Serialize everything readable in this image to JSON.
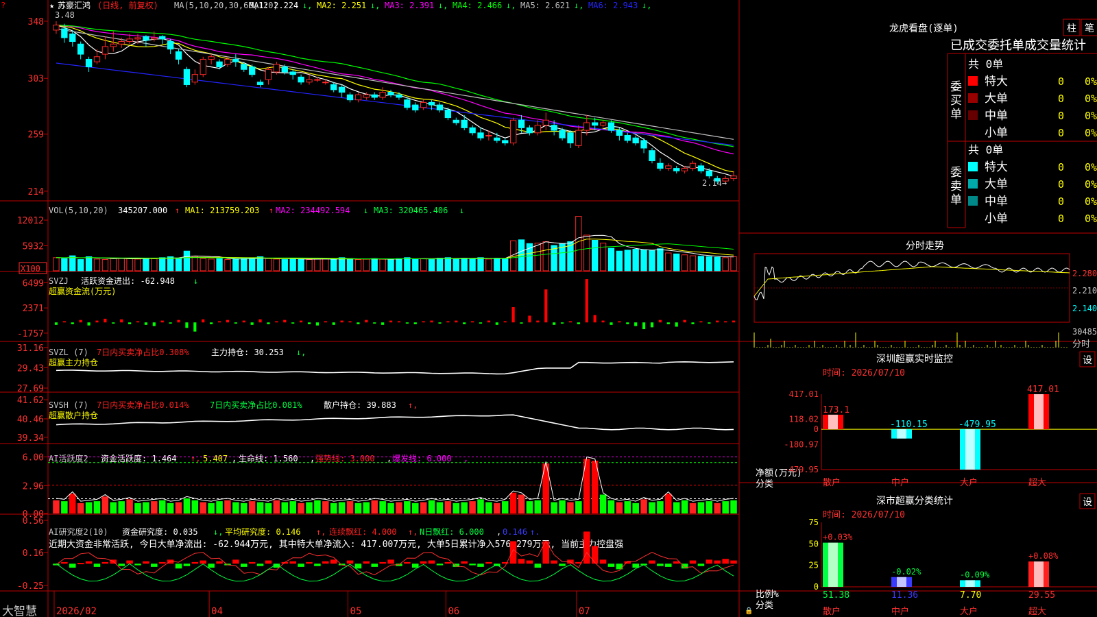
{
  "colors": {
    "up": "#ff2a2a",
    "down": "#00ffff",
    "ma1": "#ffffff",
    "ma2": "#ffff00",
    "ma3": "#ff00ff",
    "ma4": "#00ff00",
    "ma5": "#c0c0c0",
    "ma6": "#2424ff",
    "frame": "#c00000",
    "axisText": "#ff3030",
    "green": "#00ff40",
    "white": "#ffffff",
    "yellow": "#ffff00"
  },
  "kline": {
    "stock_name": "苏豪汇鸿",
    "period": "(日线, 前复权)",
    "ma_params": "MA(5,10,20,30,60,120)",
    "ma_values": [
      {
        "label": "MA1:",
        "value": "2.224",
        "arrow": "↓"
      },
      {
        "label": "MA2:",
        "value": "2.251",
        "arrow": "↓"
      },
      {
        "label": "MA3:",
        "value": "2.391",
        "arrow": "↓"
      },
      {
        "label": "MA4:",
        "value": "2.466",
        "arrow": "↓"
      },
      {
        "label": "MA5:",
        "value": "2.621",
        "arrow": "↓"
      },
      {
        "label": "MA6:",
        "value": "2.943",
        "arrow": "↓"
      }
    ],
    "y_ticks": [
      "348",
      "303",
      "259",
      "214"
    ],
    "y_tick_values": [
      3.48,
      3.03,
      2.59,
      2.14
    ],
    "range": [
      2.08,
      3.55
    ],
    "high_label": "3.48",
    "low_label": "2.14"
  },
  "vol": {
    "title": "VOL(5,10,20)",
    "value": "345207.000",
    "ma1": "MA1: 213759.203",
    "ma2": "MA2: 234492.594",
    "ma3": "MA3: 320465.406",
    "y_ticks": [
      "12012",
      "5932"
    ],
    "unit": "X100",
    "y_tick_values": [
      12012,
      5932
    ],
    "max": 13000
  },
  "svzj": {
    "title": "SVZJ",
    "desc": "活跃资金进出: -62.948",
    "arrow": "↓",
    "subtitle": "超赢资金流(万元)",
    "y_ticks": [
      "6499",
      "2371",
      "-1757"
    ],
    "y_tick_values": [
      6499,
      2371,
      -1757
    ],
    "range": [
      -3000,
      8000
    ]
  },
  "svzl": {
    "title": "SVZL (7)",
    "net": "7日内买卖净占比0.308%",
    "hold": "主力持仓: 30.253",
    "subtitle": "超赢主力持仓",
    "y_ticks": [
      "31.16",
      "29.43",
      "27.69"
    ],
    "y_tick_values": [
      31.16,
      29.43,
      27.69
    ],
    "range": [
      27.4,
      31.5
    ]
  },
  "svsh": {
    "title": "SVSH (7)",
    "net1": "7日内买卖净占比0.014%",
    "net2": "7日内买卖净占比0.081%",
    "hold": "散户持仓: 39.883",
    "subtitle": "超赢散户持仓",
    "y_ticks": [
      "41.62",
      "40.46",
      "39.34"
    ],
    "y_tick_values": [
      41.62,
      40.46,
      39.34
    ],
    "range": [
      39.0,
      42.0
    ]
  },
  "ai1": {
    "title": "AI活跃度2",
    "v1": "资金活跃度: 1.464",
    "v2": "5.407",
    "v3": "生命线: 1.560",
    "v4": "强势线: 3.000",
    "v5": "爆发线: 6.000",
    "y_ticks": [
      "6.00",
      "2.96",
      "0.00"
    ],
    "y_tick_values": [
      6.0,
      2.96,
      0.0
    ],
    "range": [
      0,
      7.2
    ]
  },
  "ai2": {
    "title": "AI研究度2(10)",
    "v1": "资金研究度: 0.035",
    "v2": "平均研究度: 0.146",
    "v3": "连续飘红: 4.000",
    "v4": "N日飘红: 6.000",
    "v5": "0.146",
    "comment": "近期大资金非常活跃, 今日大单净流出: -62.944万元, 其中特大单净流入: 417.007万元, 大单5日累计净入576.279万元, 当前主力控盘强",
    "y_ticks": [
      "0.56",
      "0.16",
      "-0.25"
    ],
    "y_tick_values": [
      0.56,
      0.16,
      -0.25
    ],
    "range": [
      -0.32,
      0.62
    ]
  },
  "xaxis": {
    "brand": "大智慧",
    "labels": [
      "2026/02",
      "04",
      "05",
      "06",
      "07"
    ],
    "label_index": [
      0,
      19,
      36,
      48,
      64
    ]
  },
  "panel_lh": {
    "title": "龙虎看盘(逐单)",
    "btn1": "柱",
    "btn2": "笔",
    "subtitle": "已成交委托单成交量统计",
    "buy_label": "委买单",
    "sell_label": "委卖单",
    "buy_total": "共 0单",
    "sell_total": "共 0单",
    "buy_rows": [
      {
        "name": "特大",
        "color": "#ff0000",
        "v": "0",
        "p": "0%"
      },
      {
        "name": "大单",
        "color": "#990000",
        "v": "0",
        "p": "0%"
      },
      {
        "name": "中单",
        "color": "#660000",
        "v": "0",
        "p": "0%"
      },
      {
        "name": "小单",
        "color": "",
        "v": "0",
        "p": "0%"
      }
    ],
    "sell_rows": [
      {
        "name": "特大",
        "color": "#00ffff",
        "v": "0",
        "p": "0%"
      },
      {
        "name": "大单",
        "color": "#00aaaa",
        "v": "0",
        "p": "0%"
      },
      {
        "name": "中单",
        "color": "#008888",
        "v": "0",
        "p": "0%"
      },
      {
        "name": "小单",
        "color": "",
        "v": "0",
        "p": "0%"
      }
    ]
  },
  "intraday": {
    "title": "分时走势",
    "y_ticks": [
      "2.280",
      "2.210",
      "2.140"
    ],
    "vol_label": "30485",
    "time_label": "分时"
  },
  "monitor": {
    "title": "深圳超赢实时监控",
    "btn": "设",
    "time": "时间: 2026/07/10",
    "y_ticks": [
      "417.01",
      "118.02",
      "0",
      "-180.97",
      "-479.95"
    ],
    "ylabel": "净额(万元)",
    "xlabel": "分类",
    "range": [
      -479.95,
      417.01
    ],
    "bars": [
      {
        "name": "散户",
        "value": 173.1,
        "label": "173.1"
      },
      {
        "name": "中户",
        "value": -110.15,
        "label": "-110.15"
      },
      {
        "name": "大户",
        "value": -479.95,
        "label": "-479.95"
      },
      {
        "name": "超大",
        "value": 417.01,
        "label": "417.01"
      }
    ]
  },
  "classify": {
    "title": "深市超赢分类统计",
    "btn": "设",
    "time": "时间: 2026/07/10",
    "y_ticks": [
      "75",
      "50",
      "25",
      "0"
    ],
    "ylabel": "比例%",
    "xlabel": "分类",
    "bars": [
      {
        "name": "散户",
        "value": 51.38,
        "label": "51.38",
        "change": "+0.03%"
      },
      {
        "name": "中户",
        "value": 11.36,
        "label": "11.36",
        "change": "-0.02%"
      },
      {
        "name": "大户",
        "value": 7.7,
        "label": "7.70",
        "change": "-0.09%"
      },
      {
        "name": "超大",
        "value": 29.55,
        "label": "29.55",
        "change": "+0.08%"
      }
    ]
  },
  "candles": [
    [
      3.41,
      3.45,
      3.38,
      3.48
    ],
    [
      3.42,
      3.35,
      3.31,
      3.46
    ],
    [
      3.38,
      3.32,
      3.28,
      3.41
    ],
    [
      3.3,
      3.22,
      3.18,
      3.32
    ],
    [
      3.18,
      3.12,
      3.08,
      3.2
    ],
    [
      3.16,
      3.2,
      3.14,
      3.26
    ],
    [
      3.22,
      3.28,
      3.18,
      3.36
    ],
    [
      3.28,
      3.3,
      3.24,
      3.4
    ],
    [
      3.3,
      3.32,
      3.27,
      3.35
    ],
    [
      3.32,
      3.34,
      3.3,
      3.38
    ],
    [
      3.34,
      3.35,
      3.3,
      3.38
    ],
    [
      3.36,
      3.33,
      3.28,
      3.37
    ],
    [
      3.34,
      3.35,
      3.32,
      3.4
    ],
    [
      3.36,
      3.34,
      3.3,
      3.37
    ],
    [
      3.32,
      3.26,
      3.22,
      3.34
    ],
    [
      3.24,
      3.18,
      3.14,
      3.26
    ],
    [
      3.1,
      2.98,
      2.96,
      3.12
    ],
    [
      3.0,
      3.06,
      2.98,
      3.1
    ],
    [
      3.06,
      3.18,
      3.04,
      3.2
    ],
    [
      3.18,
      3.2,
      3.14,
      3.22
    ],
    [
      3.16,
      3.12,
      3.1,
      3.18
    ],
    [
      3.14,
      3.18,
      3.12,
      3.2
    ],
    [
      3.18,
      3.16,
      3.12,
      3.22
    ],
    [
      3.14,
      3.1,
      3.08,
      3.16
    ],
    [
      3.12,
      3.06,
      3.04,
      3.14
    ],
    [
      3.0,
      2.98,
      2.96,
      3.02
    ],
    [
      3.02,
      3.1,
      2.98,
      3.12
    ],
    [
      3.08,
      3.14,
      3.06,
      3.16
    ],
    [
      3.12,
      3.08,
      3.06,
      3.14
    ],
    [
      3.08,
      3.06,
      3.02,
      3.1
    ],
    [
      3.04,
      3.0,
      2.98,
      3.06
    ],
    [
      3.0,
      3.02,
      2.98,
      3.06
    ],
    [
      3.02,
      3.02,
      3.0,
      3.04
    ],
    [
      3.0,
      3.0,
      2.98,
      3.02
    ],
    [
      2.98,
      2.94,
      2.92,
      3.0
    ],
    [
      2.96,
      2.92,
      2.88,
      2.98
    ],
    [
      2.9,
      2.86,
      2.84,
      2.92
    ],
    [
      2.86,
      2.9,
      2.84,
      2.92
    ],
    [
      2.88,
      2.9,
      2.86,
      2.92
    ],
    [
      2.9,
      2.88,
      2.86,
      2.92
    ],
    [
      2.88,
      2.92,
      2.86,
      2.96
    ],
    [
      2.92,
      2.9,
      2.88,
      2.94
    ],
    [
      2.9,
      2.88,
      2.86,
      2.92
    ],
    [
      2.86,
      2.8,
      2.78,
      2.88
    ],
    [
      2.82,
      2.78,
      2.76,
      2.84
    ],
    [
      2.8,
      2.84,
      2.78,
      2.86
    ],
    [
      2.84,
      2.82,
      2.78,
      2.86
    ],
    [
      2.82,
      2.78,
      2.76,
      2.84
    ],
    [
      2.78,
      2.72,
      2.7,
      2.8
    ],
    [
      2.7,
      2.68,
      2.66,
      2.72
    ],
    [
      2.7,
      2.64,
      2.62,
      2.74
    ],
    [
      2.64,
      2.6,
      2.58,
      2.66
    ],
    [
      2.6,
      2.56,
      2.54,
      2.64
    ],
    [
      2.58,
      2.58,
      2.54,
      2.62
    ],
    [
      2.56,
      2.54,
      2.52,
      2.6
    ],
    [
      2.54,
      2.52,
      2.5,
      2.56
    ],
    [
      2.52,
      2.7,
      2.5,
      2.72
    ],
    [
      2.7,
      2.64,
      2.6,
      2.74
    ],
    [
      2.64,
      2.6,
      2.58,
      2.66
    ],
    [
      2.6,
      2.66,
      2.58,
      2.7
    ],
    [
      2.66,
      2.7,
      2.62,
      2.76
    ],
    [
      2.66,
      2.62,
      2.58,
      2.7
    ],
    [
      2.62,
      2.56,
      2.54,
      2.64
    ],
    [
      2.6,
      2.52,
      2.48,
      2.62
    ],
    [
      2.5,
      2.62,
      2.48,
      2.66
    ],
    [
      2.62,
      2.68,
      2.58,
      2.74
    ],
    [
      2.68,
      2.66,
      2.62,
      2.72
    ],
    [
      2.66,
      2.68,
      2.64,
      2.7
    ],
    [
      2.68,
      2.62,
      2.6,
      2.7
    ],
    [
      2.62,
      2.58,
      2.54,
      2.64
    ],
    [
      2.58,
      2.54,
      2.52,
      2.6
    ],
    [
      2.56,
      2.52,
      2.5,
      2.58
    ],
    [
      2.54,
      2.48,
      2.44,
      2.56
    ],
    [
      2.46,
      2.38,
      2.36,
      2.48
    ],
    [
      2.36,
      2.32,
      2.3,
      2.4
    ],
    [
      2.32,
      2.34,
      2.3,
      2.36
    ],
    [
      2.32,
      2.3,
      2.28,
      2.34
    ],
    [
      2.3,
      2.32,
      2.28,
      2.34
    ],
    [
      2.32,
      2.36,
      2.3,
      2.38
    ],
    [
      2.34,
      2.3,
      2.28,
      2.36
    ],
    [
      2.3,
      2.26,
      2.24,
      2.32
    ],
    [
      2.24,
      2.22,
      2.2,
      2.26
    ],
    [
      2.22,
      2.24,
      2.2,
      2.26
    ],
    [
      2.24,
      2.26,
      2.22,
      2.3
    ]
  ],
  "volumes": [
    2800,
    2600,
    3200,
    2400,
    3000,
    2500,
    2400,
    2600,
    2700,
    2600,
    2500,
    2700,
    2600,
    2800,
    3000,
    2700,
    4200,
    3100,
    2600,
    2500,
    2600,
    2400,
    2500,
    2600,
    2700,
    3000,
    2600,
    2500,
    2400,
    2600,
    2500,
    2400,
    2500,
    2600,
    2400,
    2800,
    2600,
    2400,
    2500,
    2600,
    2500,
    2400,
    2600,
    2800,
    2500,
    2600,
    2500,
    2700,
    2800,
    2600,
    2700,
    2600,
    2800,
    2500,
    2700,
    2600,
    6400,
    6600,
    5800,
    5900,
    6200,
    5400,
    5800,
    6200,
    11600,
    7600,
    6500,
    5900,
    4800,
    4200,
    4400,
    4600,
    4500,
    4300,
    4700,
    3800,
    3600,
    3400,
    3200,
    3100,
    3000,
    2900,
    2800,
    3000
  ],
  "svzj_vals": [
    -400,
    200,
    -300,
    400,
    -500,
    300,
    600,
    -200,
    500,
    -300,
    200,
    -400,
    -600,
    300,
    -200,
    400,
    -900,
    -1500,
    500,
    -300,
    200,
    400,
    -200,
    300,
    -400,
    500,
    -300,
    200,
    400,
    -200,
    300,
    -300,
    -500,
    200,
    -400,
    300,
    200,
    -300,
    400,
    -200,
    -400,
    300,
    200,
    -200,
    -300,
    200,
    300,
    -200,
    200,
    300,
    -300,
    200,
    -200,
    300,
    -400,
    200,
    2500,
    -200,
    1100,
    300,
    5400,
    -400,
    -200,
    200,
    -300,
    7100,
    1200,
    300,
    -400,
    200,
    -300,
    -600,
    -1100,
    -800,
    400,
    -300,
    -700,
    400,
    -300,
    200,
    -200,
    300,
    200,
    300
  ],
  "ai1_vals": [
    1.4,
    1.3,
    2.1,
    1.1,
    1.2,
    1.3,
    1.8,
    1.2,
    1.3,
    1.5,
    1.1,
    1.2,
    1.3,
    1.4,
    1.1,
    1.2,
    1.6,
    1.4,
    1.2,
    1.1,
    1.3,
    1.4,
    1.2,
    1.1,
    1.3,
    1.2,
    1.1,
    1.4,
    1.2,
    1.3,
    1.1,
    1.2,
    1.4,
    1.3,
    1.1,
    1.2,
    1.3,
    1.1,
    1.2,
    1.4,
    1.3,
    1.1,
    1.2,
    1.3,
    1.1,
    1.2,
    1.4,
    1.2,
    1.3,
    1.1,
    1.2,
    1.3,
    1.5,
    1.2,
    1.1,
    1.3,
    2.2,
    2.0,
    1.3,
    1.4,
    5.3,
    1.2,
    1.4,
    1.2,
    1.3,
    5.8,
    5.6,
    2.0,
    1.4,
    1.2,
    1.3,
    1.1,
    1.5,
    1.2,
    1.3,
    2.1,
    1.2,
    1.4,
    1.1,
    1.2,
    1.3,
    1.1,
    1.3,
    1.4
  ],
  "ai2_vals": [
    -0.02,
    0.02,
    -0.05,
    0.01,
    0.03,
    -0.04,
    0.02,
    0.05,
    -0.03,
    0.04,
    -0.02,
    0.03,
    -0.04,
    0.02,
    0.05,
    -0.06,
    -0.03,
    0.02,
    0.04,
    -0.05,
    0.03,
    -0.02,
    0.05,
    -0.04,
    0.02,
    -0.03,
    0.04,
    -0.05,
    0.02,
    0.03,
    -0.04,
    0.02,
    -0.03,
    0.03,
    0.05,
    -0.02,
    0.04,
    -0.06,
    0.03,
    -0.04,
    0.02,
    0.05,
    -0.03,
    0.02,
    -0.05,
    0.03,
    0.04,
    -0.02,
    0.02,
    -0.04,
    0.03,
    -0.02,
    -0.04,
    0.02,
    -0.03,
    0.02,
    0.28,
    0.06,
    0.04,
    -0.05,
    0.28,
    0.04,
    -0.03,
    0.05,
    0.02,
    0.4,
    0.22,
    0.05,
    -0.04,
    -0.07,
    0.03,
    -0.05,
    -0.02,
    0.04,
    -0.03,
    -0.04,
    0.03,
    -0.06,
    0.04,
    -0.03,
    0.05,
    0.04,
    0.06,
    0.04
  ]
}
